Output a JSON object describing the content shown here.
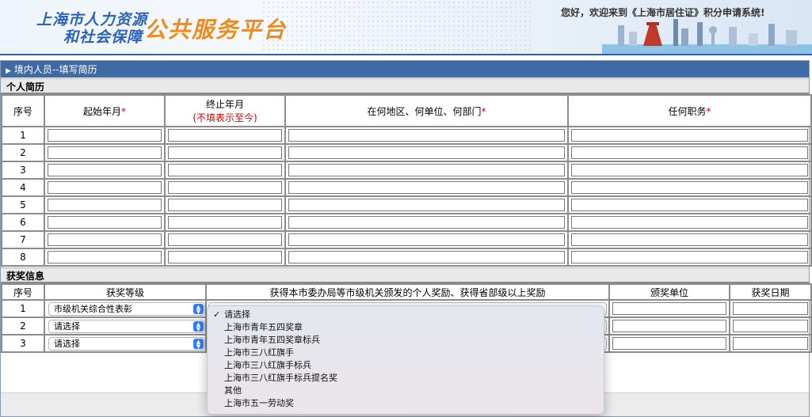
{
  "header": {
    "logo_line1": "上海市人力资源",
    "logo_line2": "和社会保障",
    "brand": "公共服务平台",
    "welcome": "您好，欢迎来到《上海市居住证》积分申请系统!"
  },
  "page_title": "境内人员--填写简历",
  "resume": {
    "section_title": "个人简历",
    "headers": {
      "seq": "序号",
      "start": "起始年月",
      "end": "终止年月",
      "end_note": "(不填表示至今)",
      "place": "在何地区、何单位、何部门",
      "position": "任何职务",
      "required_mark": "*"
    },
    "rows": [
      "1",
      "2",
      "3",
      "4",
      "5",
      "6",
      "7",
      "8"
    ]
  },
  "awards": {
    "section_title": "获奖信息",
    "headers": {
      "seq": "序号",
      "level": "获奖等级",
      "award": "获得本市委办局等市级机关颁发的个人奖励、获得省部级以上奖励",
      "issuer": "颁奖单位",
      "date": "获奖日期"
    },
    "rows": [
      {
        "seq": "1",
        "level": "市级机关综合性表彰"
      },
      {
        "seq": "2",
        "level": "请选择"
      },
      {
        "seq": "3",
        "level": "请选择"
      }
    ],
    "dropdown_options": [
      "请选择",
      "上海市青年五四奖章",
      "上海市青年五四奖章标兵",
      "上海市三八红旗手",
      "上海市三八红旗手标兵",
      "上海市三八红旗手标兵提名奖",
      "其他",
      "上海市五一劳动奖"
    ],
    "dropdown_selected": "请选择"
  },
  "colors": {
    "title_bar": "#3e6ba5",
    "brand_orange": "#f08a1a",
    "logo_blue": "#2b63b8",
    "required_red": "#d40000"
  }
}
